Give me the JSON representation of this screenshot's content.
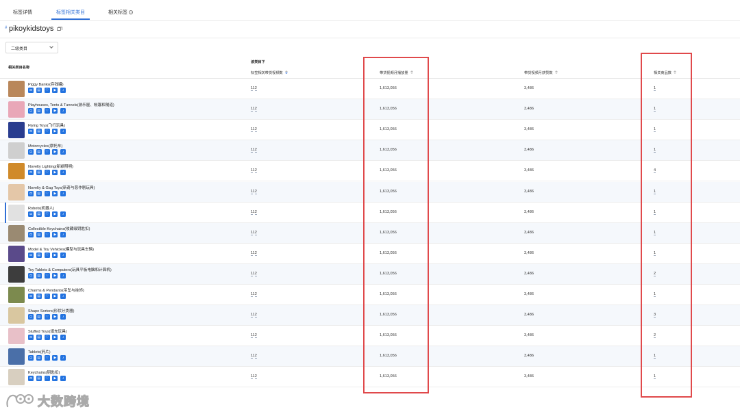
{
  "tabs": [
    {
      "label": "标签详情"
    },
    {
      "label": "标签相关类目",
      "active": true
    },
    {
      "label": "相关标签",
      "help": "?"
    }
  ],
  "header": {
    "hash": "#",
    "title": "pikoykidstoys"
  },
  "filter": {
    "selected": "二级类目"
  },
  "table": {
    "group_header": "该类目下",
    "headers": {
      "name": "相关类目名称",
      "videos": "标签相关带货视频数",
      "plays": "带货视频月播放量",
      "likes": "带货视频月获赞数",
      "products": "相关商品数"
    },
    "rows": [
      {
        "name": "Piggy Banks(存钱罐)",
        "videos": "112",
        "plays": "1,613,056",
        "likes": "3,486",
        "products": "1"
      },
      {
        "name": "Playhouses, Tents & Tunnels(游乐屋、帐篷和隧道)",
        "videos": "112",
        "plays": "1,613,056",
        "likes": "3,486",
        "products": "1"
      },
      {
        "name": "Flying Toys(飞行玩具)",
        "videos": "112",
        "plays": "1,613,056",
        "likes": "3,486",
        "products": "1"
      },
      {
        "name": "Motorcycles(摩托车)",
        "videos": "112",
        "plays": "1,613,056",
        "likes": "3,486",
        "products": "1"
      },
      {
        "name": "Novelty Lighting(新颖照明)",
        "videos": "112",
        "plays": "1,613,056",
        "likes": "3,486",
        "products": "4"
      },
      {
        "name": "Novelty & Gag Toys(新奇与恶作剧玩具)",
        "videos": "112",
        "plays": "1,613,056",
        "likes": "3,486",
        "products": "1"
      },
      {
        "name": "Robots(机器人)",
        "videos": "112",
        "plays": "1,613,056",
        "likes": "3,486",
        "products": "1"
      },
      {
        "name": "Collectible Keychains(收藏级钥匙扣)",
        "videos": "112",
        "plays": "1,613,056",
        "likes": "3,486",
        "products": "1"
      },
      {
        "name": "Model & Toy Vehicles(模型与玩具车辆)",
        "videos": "112",
        "plays": "1,613,056",
        "likes": "3,486",
        "products": "1"
      },
      {
        "name": "Toy Tablets & Computers(玩具平板电脑和计算机)",
        "videos": "112",
        "plays": "1,613,056",
        "likes": "3,486",
        "products": "2"
      },
      {
        "name": "Charms & Pendants(吊坠与挂饰)",
        "videos": "112",
        "plays": "1,613,056",
        "likes": "3,486",
        "products": "1"
      },
      {
        "name": "Shape Sorters(形状分类器)",
        "videos": "112",
        "plays": "1,613,056",
        "likes": "3,486",
        "products": "3"
      },
      {
        "name": "Stuffed Toys(填充玩具)",
        "videos": "112",
        "plays": "1,613,056",
        "likes": "3,486",
        "products": "2"
      },
      {
        "name": "Tablets(药片)",
        "videos": "112",
        "plays": "1,613,056",
        "likes": "3,486",
        "products": "1"
      },
      {
        "name": "Keychains(钥匙扣)",
        "videos": "112",
        "plays": "1,613,056",
        "likes": "3,486",
        "products": "1"
      }
    ],
    "thumb_colors": [
      "#b9875a",
      "#e9a7b8",
      "#2a3d8f",
      "#cfcfcf",
      "#d08a2a",
      "#e4c7a8",
      "#e1e1e1",
      "#9a8a72",
      "#5a4a8a",
      "#3d3d3d",
      "#7c8a4e",
      "#d9c7a0",
      "#e8c0c8",
      "#4a6fa8",
      "#d8cfc0"
    ],
    "row_icons": [
      "tiktok-shop-icon",
      "copy-icon",
      "heart-icon",
      "video-icon",
      "tiktok-icon"
    ]
  },
  "colors": {
    "accent": "#2f6fd6",
    "highlight": "#e0494b",
    "icon_blue": "#2373e0"
  },
  "branding": {
    "logo_text": "大数跨境"
  }
}
